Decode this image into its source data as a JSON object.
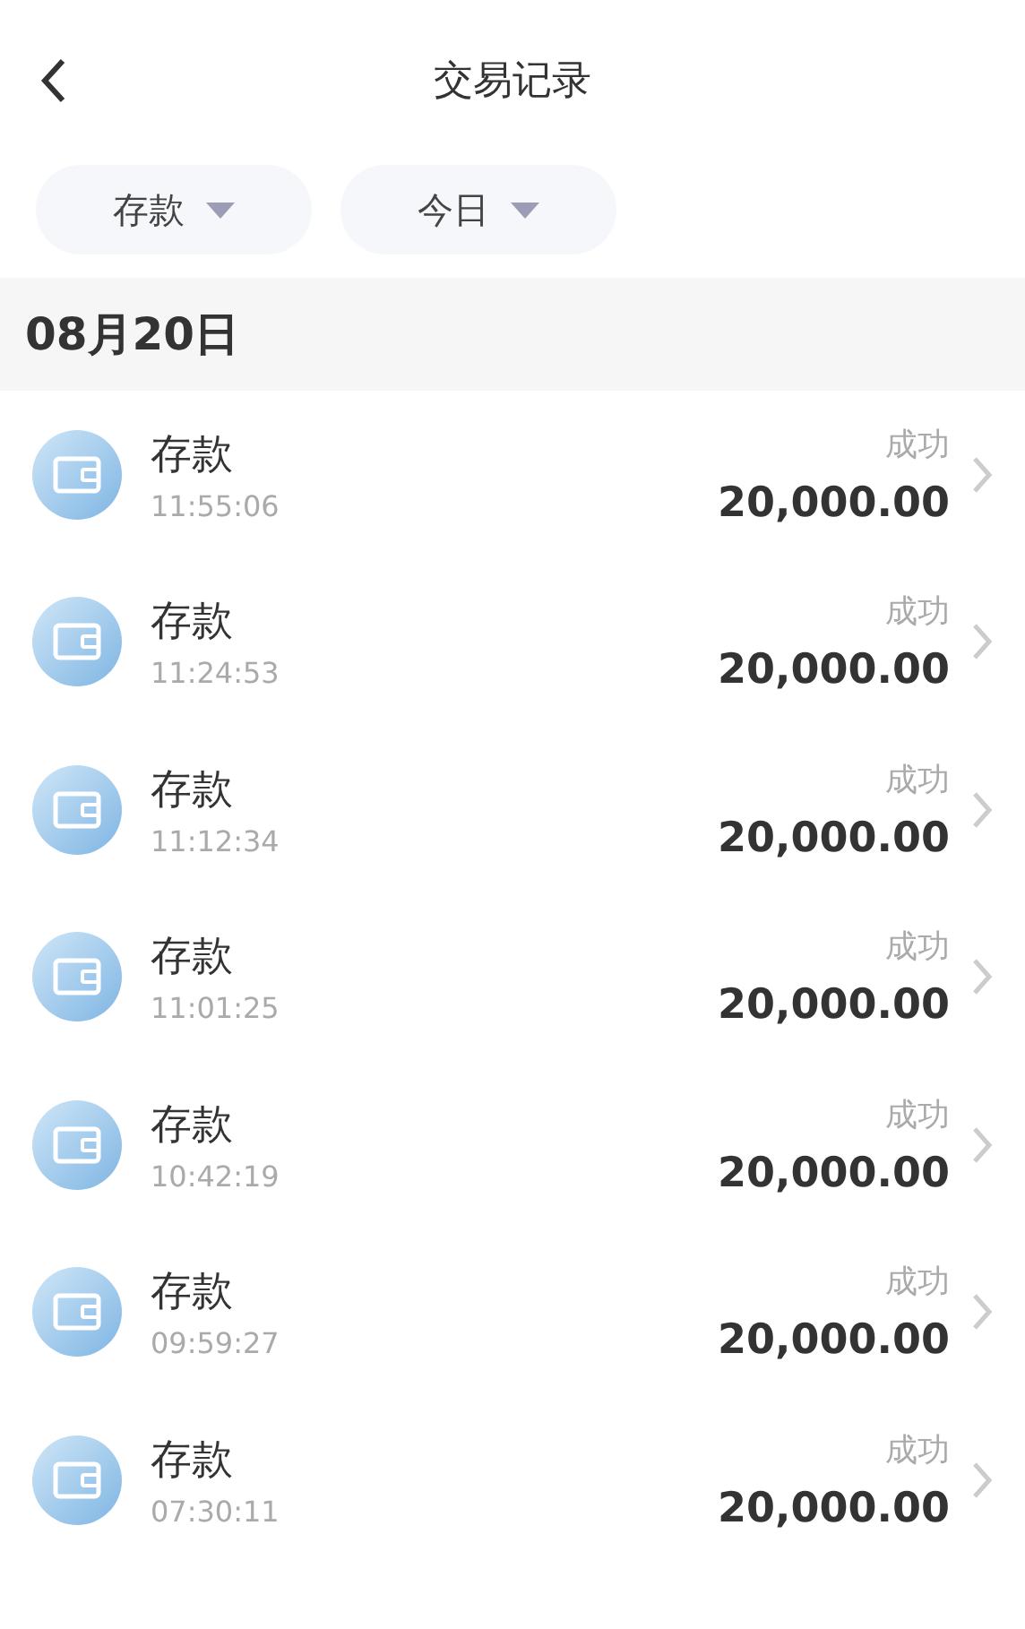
{
  "header": {
    "title": "交易记录"
  },
  "filters": [
    {
      "label": "存款"
    },
    {
      "label": "今日"
    }
  ],
  "date": "08月20日",
  "transactions": [
    {
      "type": "存款",
      "time": "11:55:06",
      "status": "成功",
      "amount": "20,000.00"
    },
    {
      "type": "存款",
      "time": "11:24:53",
      "status": "成功",
      "amount": "20,000.00"
    },
    {
      "type": "存款",
      "time": "11:12:34",
      "status": "成功",
      "amount": "20,000.00"
    },
    {
      "type": "存款",
      "time": "11:01:25",
      "status": "成功",
      "amount": "20,000.00"
    },
    {
      "type": "存款",
      "time": "10:42:19",
      "status": "成功",
      "amount": "20,000.00"
    },
    {
      "type": "存款",
      "time": "09:59:27",
      "status": "成功",
      "amount": "20,000.00"
    },
    {
      "type": "存款",
      "time": "07:30:11",
      "status": "成功",
      "amount": "20,000.00"
    }
  ]
}
